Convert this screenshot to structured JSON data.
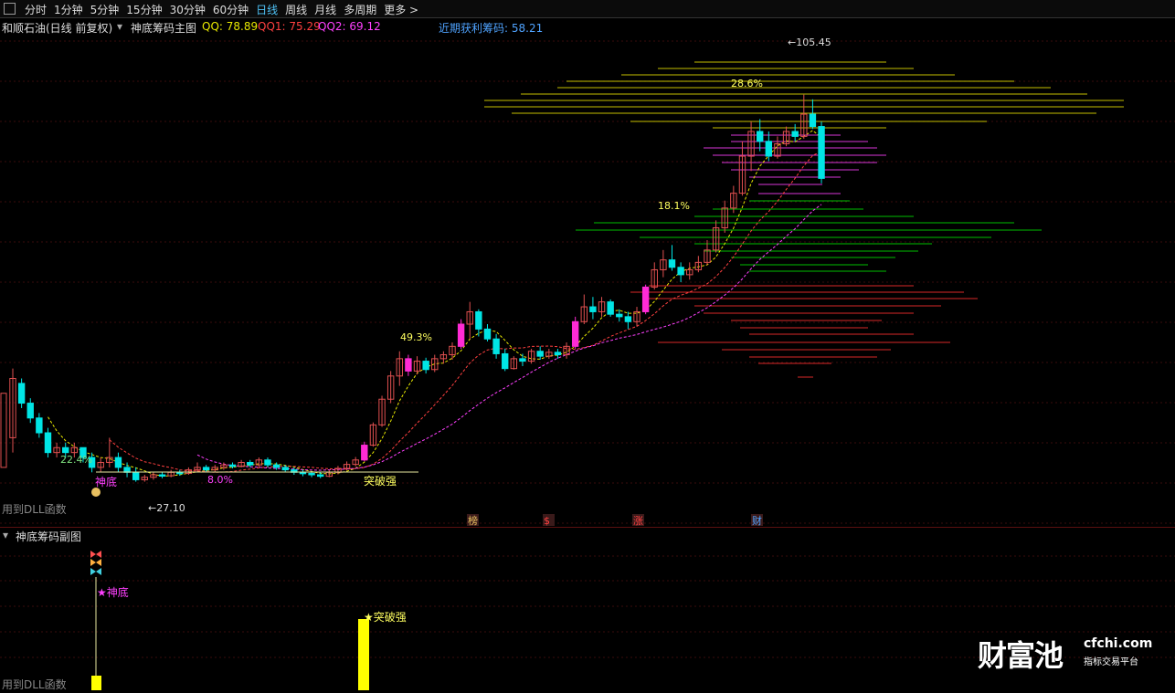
{
  "toolbar": {
    "periods": [
      "分时",
      "1分钟",
      "5分钟",
      "15分钟",
      "30分钟",
      "60分钟",
      "日线",
      "周线",
      "月线",
      "多周期",
      "更多 >"
    ],
    "active_period": "日线"
  },
  "main_chart": {
    "stock_name": "和顺石油(日线 前复权)",
    "indicator_name": "神底筹码主图",
    "qq_label": "QQ: 78.89",
    "qq1_label": "QQ1: 75.29",
    "qq2_label": "QQ2: 69.12",
    "profit_label": "近期获利筹码: 58.21",
    "dll_note": "用到DLL函数",
    "annotations": {
      "high_price": "105.45",
      "low_price": "27.10",
      "pct_1": "22.4%",
      "pct_2": "8.0%",
      "pct_3": "49.3%",
      "pct_4": "18.1%",
      "pct_5": "28.6%",
      "shendi": "神底",
      "tupoqiang": "突破强"
    },
    "markers": [
      "榜",
      "$",
      "涨",
      "财"
    ]
  },
  "sub_chart": {
    "title": "神底筹码副图",
    "shendi_label": "★神底",
    "tupo_label": "★突破强",
    "dll_note": "用到DLL函数"
  },
  "brand": {
    "name": "财富池",
    "domain": "cfchi.com",
    "slogan": "指标交易平台"
  },
  "colors": {
    "up": "#e05050",
    "down": "#00e5e5",
    "magenta": "#ff2bd5",
    "yellow": "#ffff00",
    "qq": "#e8e800",
    "qq1": "#ff4040",
    "qq2": "#ff40ff",
    "profit": "#4fa3ff"
  },
  "chart_data": {
    "type": "candlestick",
    "title": "和顺石油(日线 前复权)",
    "price_range": [
      20,
      115
    ],
    "high_mark": 105.45,
    "low_mark": 27.1,
    "candles": [
      [
        36,
        48,
        33,
        50
      ],
      [
        47,
        43,
        42,
        48
      ],
      [
        43,
        40,
        39,
        44
      ],
      [
        40,
        37,
        36,
        41
      ],
      [
        37,
        33,
        32,
        38
      ],
      [
        33,
        34,
        32,
        35
      ],
      [
        34,
        33,
        32,
        35
      ],
      [
        33,
        34,
        32,
        35
      ],
      [
        34,
        32,
        31,
        34
      ],
      [
        32,
        30,
        29,
        33
      ],
      [
        30,
        31,
        29,
        32
      ],
      [
        31,
        32,
        30,
        36
      ],
      [
        32,
        30,
        29,
        33
      ],
      [
        30,
        29,
        28,
        31
      ],
      [
        29,
        27.5,
        27.1,
        30
      ],
      [
        27.5,
        28,
        27.1,
        28.5
      ],
      [
        28,
        28.5,
        27.5,
        29
      ],
      [
        28.5,
        28.3,
        27.8,
        29
      ],
      [
        28.3,
        29,
        28,
        29.5
      ],
      [
        29,
        28.8,
        28.3,
        29.5
      ],
      [
        28.8,
        29.5,
        28.5,
        30
      ],
      [
        29.5,
        30,
        29,
        31
      ],
      [
        30,
        29.5,
        29,
        30.5
      ],
      [
        29.5,
        30,
        29,
        30.5
      ],
      [
        30,
        30.5,
        29.5,
        31
      ],
      [
        30.5,
        30.2,
        29.8,
        31
      ],
      [
        30.2,
        31,
        30,
        31.5
      ],
      [
        31,
        30.5,
        30,
        31.5
      ],
      [
        30.5,
        31.5,
        30,
        32
      ],
      [
        31.5,
        30.5,
        30,
        32
      ],
      [
        30.5,
        30,
        29.5,
        31
      ],
      [
        30,
        29.5,
        29,
        30.5
      ],
      [
        29.5,
        29,
        28.5,
        30
      ],
      [
        29,
        28.8,
        28.2,
        29.5
      ],
      [
        28.8,
        28.5,
        28,
        29.2
      ],
      [
        28.5,
        28.2,
        27.8,
        29
      ],
      [
        28.2,
        29,
        28,
        29.5
      ],
      [
        29,
        29.8,
        28.6,
        30.3
      ],
      [
        29.8,
        30.6,
        29.4,
        31.2
      ],
      [
        30.6,
        31.5,
        30.2,
        32.1
      ],
      [
        31.5,
        34.5,
        31.2,
        35.2
      ],
      [
        34.5,
        38.6,
        34.2,
        39.1
      ],
      [
        38.6,
        43.8,
        38.2,
        44.5
      ],
      [
        43.8,
        48.5,
        43,
        49.5
      ],
      [
        48.5,
        52,
        46.5,
        53.5
      ],
      [
        52,
        49.5,
        48.5,
        52.8
      ],
      [
        49.5,
        51.5,
        48.8,
        52.5
      ],
      [
        51.5,
        49.8,
        49,
        52.2
      ],
      [
        49.8,
        52,
        49.3,
        52.8
      ],
      [
        52,
        52.8,
        51,
        53.5
      ],
      [
        52.8,
        54.5,
        51.8,
        55.3
      ],
      [
        54.5,
        59,
        54,
        60
      ],
      [
        59,
        61.5,
        56,
        63.5
      ],
      [
        61.5,
        58,
        56.5,
        62
      ],
      [
        58,
        56,
        55.5,
        59
      ],
      [
        56,
        53,
        52,
        57
      ],
      [
        53,
        50,
        49.5,
        54
      ],
      [
        50,
        52,
        49.8,
        52.5
      ],
      [
        52,
        51.5,
        50.5,
        53
      ],
      [
        51.5,
        53.5,
        51,
        54
      ],
      [
        53.5,
        52.5,
        51.8,
        54.5
      ],
      [
        52.5,
        53.3,
        52,
        54
      ],
      [
        53.3,
        52.8,
        52,
        54
      ],
      [
        52.8,
        54.5,
        52,
        55.3
      ],
      [
        54.5,
        59.5,
        54,
        60.5
      ],
      [
        59.5,
        62.5,
        59,
        65
      ],
      [
        62.5,
        61.5,
        60,
        64.5
      ],
      [
        61.5,
        63.5,
        60.5,
        64.5
      ],
      [
        63.5,
        61,
        60.5,
        64
      ],
      [
        61,
        60.5,
        59.5,
        62
      ],
      [
        60.5,
        59.5,
        58,
        61.5
      ],
      [
        59.5,
        61.5,
        58.5,
        62.5
      ],
      [
        61.5,
        66.5,
        61,
        67
      ],
      [
        66.5,
        70,
        66,
        71.5
      ],
      [
        70,
        72,
        68.5,
        74
      ],
      [
        72,
        70.5,
        69.8,
        75
      ],
      [
        70.5,
        69,
        67.5,
        71.5
      ],
      [
        69,
        70,
        68,
        71.5
      ],
      [
        70,
        71.5,
        69.5,
        72.8
      ],
      [
        71.5,
        74,
        71,
        76
      ],
      [
        74,
        78.5,
        73.5,
        80
      ],
      [
        78.5,
        82.5,
        77.5,
        84
      ],
      [
        82.5,
        85.5,
        81.5,
        87
      ],
      [
        85.5,
        93,
        85,
        96
      ],
      [
        93,
        98,
        90,
        100
      ],
      [
        98,
        96,
        94,
        100.5
      ],
      [
        96,
        93,
        92,
        98
      ],
      [
        93,
        95.5,
        92.5,
        97
      ],
      [
        95.5,
        98,
        95,
        99
      ],
      [
        98,
        97,
        96,
        99.5
      ],
      [
        97,
        101.5,
        96.5,
        105.45
      ],
      [
        101.5,
        99,
        98.5,
        104.5
      ],
      [
        99,
        88.5,
        87.5,
        100
      ]
    ]
  }
}
